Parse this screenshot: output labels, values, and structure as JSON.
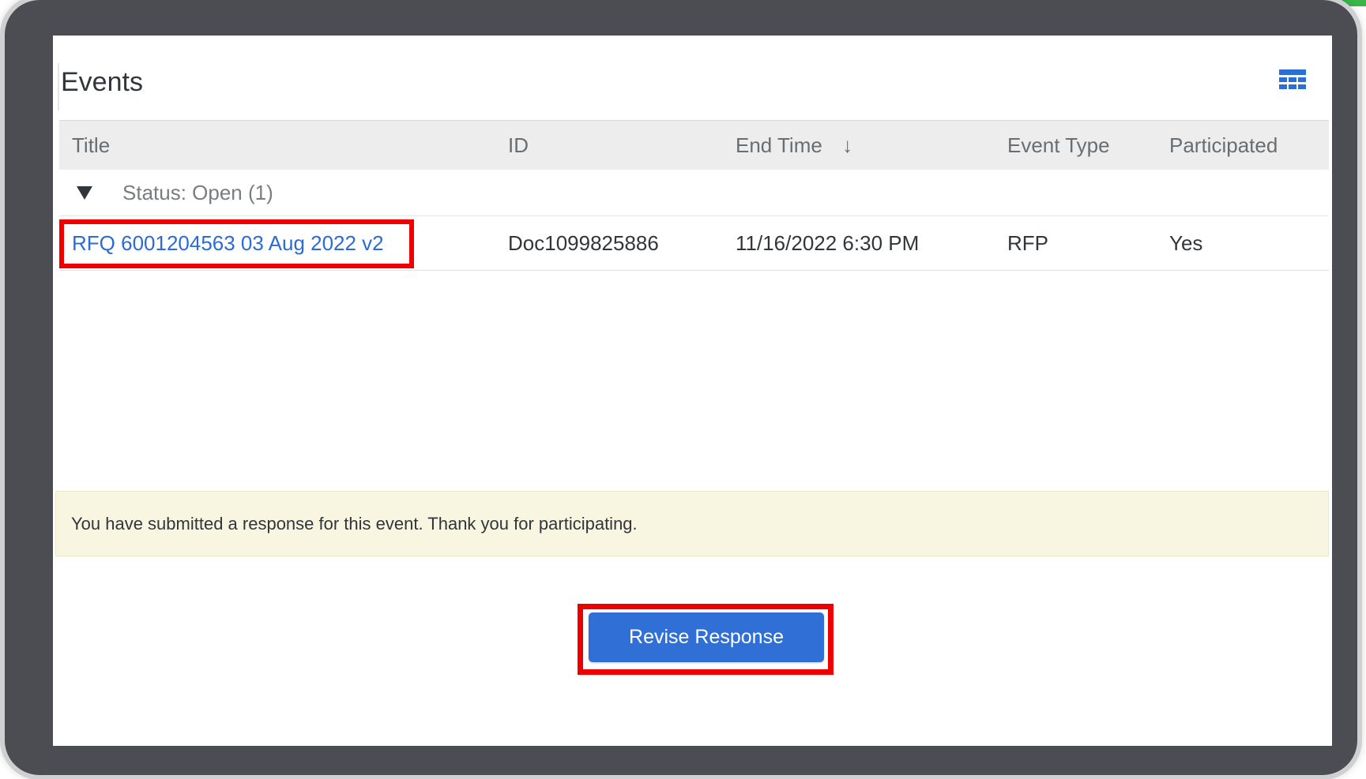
{
  "page": {
    "title": "Events"
  },
  "table": {
    "columns": [
      {
        "label": "Title"
      },
      {
        "label": "ID"
      },
      {
        "label": "End Time",
        "sort": "descending"
      },
      {
        "label": "Event Type"
      },
      {
        "label": "Participated"
      }
    ],
    "groups": [
      {
        "label": "Status: Open  (1)",
        "expanded": true,
        "rows": [
          {
            "title": "RFQ 6001204563 03 Aug 2022 v2",
            "id": "Doc1099825886",
            "end_time": "11/16/2022 6:30 PM",
            "event_type": "RFP",
            "participated": "Yes"
          }
        ]
      }
    ]
  },
  "notice": {
    "text": "You have submitted a response for this event.  Thank you for participating."
  },
  "actions": {
    "revise_label": "Revise Response"
  },
  "icons": {
    "table_settings": "grid-icon",
    "sort": "arrow-down-icon",
    "group_toggle": "triangle-down-icon"
  },
  "colors": {
    "link": "#2c6ad6",
    "primary_button": "#2f6fd6",
    "highlight": "#ef0000",
    "notice_background": "#f8f5e0",
    "frame": "#4c4d52",
    "header_background": "#ededed",
    "accent": "#3ab54a"
  }
}
